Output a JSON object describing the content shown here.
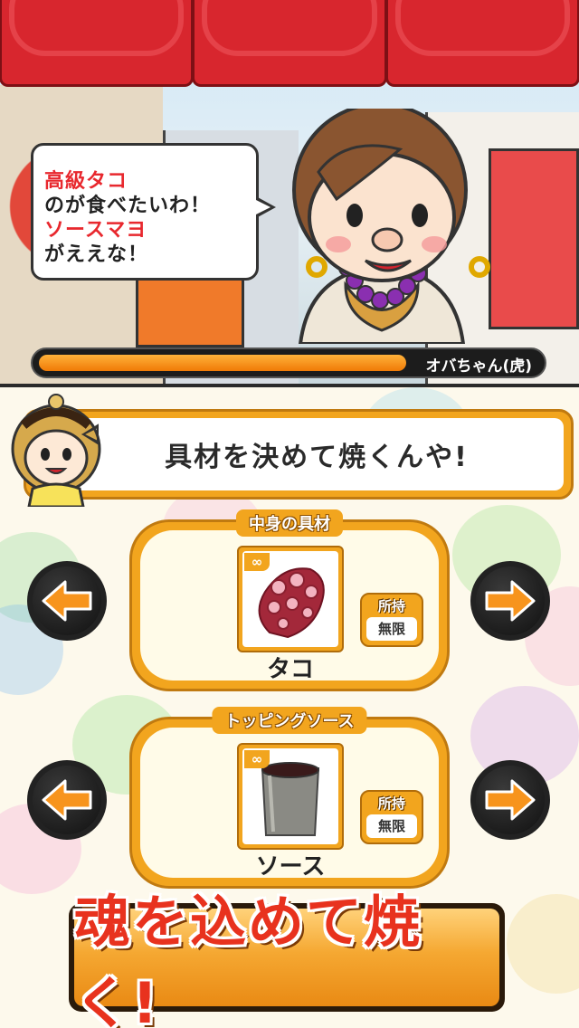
{
  "speech": {
    "line1": "高級タコ",
    "line2": "のが食べたいわ！",
    "line3": "ソースマヨ",
    "line4": "がええな！"
  },
  "customer": {
    "name": "オバちゃん(虎)",
    "hp_fraction": 0.73
  },
  "instruction": "具材を決めて焼くんや!",
  "filling": {
    "header": "中身の具材",
    "item": "タコ",
    "infinity": "∞",
    "stock_label": "所持",
    "stock_value": "無限"
  },
  "topping": {
    "header": "トッピングソース",
    "item": "ソース",
    "infinity": "∞",
    "stock_label": "所持",
    "stock_value": "無限"
  },
  "cta_label": "魂を込めて焼く!",
  "colors": {
    "accent_orange": "#f2a51e",
    "title_red": "#e8282e",
    "arrow_orange": "#f7941d"
  },
  "icons": [
    "arrow-left-icon",
    "arrow-right-icon",
    "octopus-icon",
    "sauce-can-icon",
    "infinity-icon"
  ]
}
